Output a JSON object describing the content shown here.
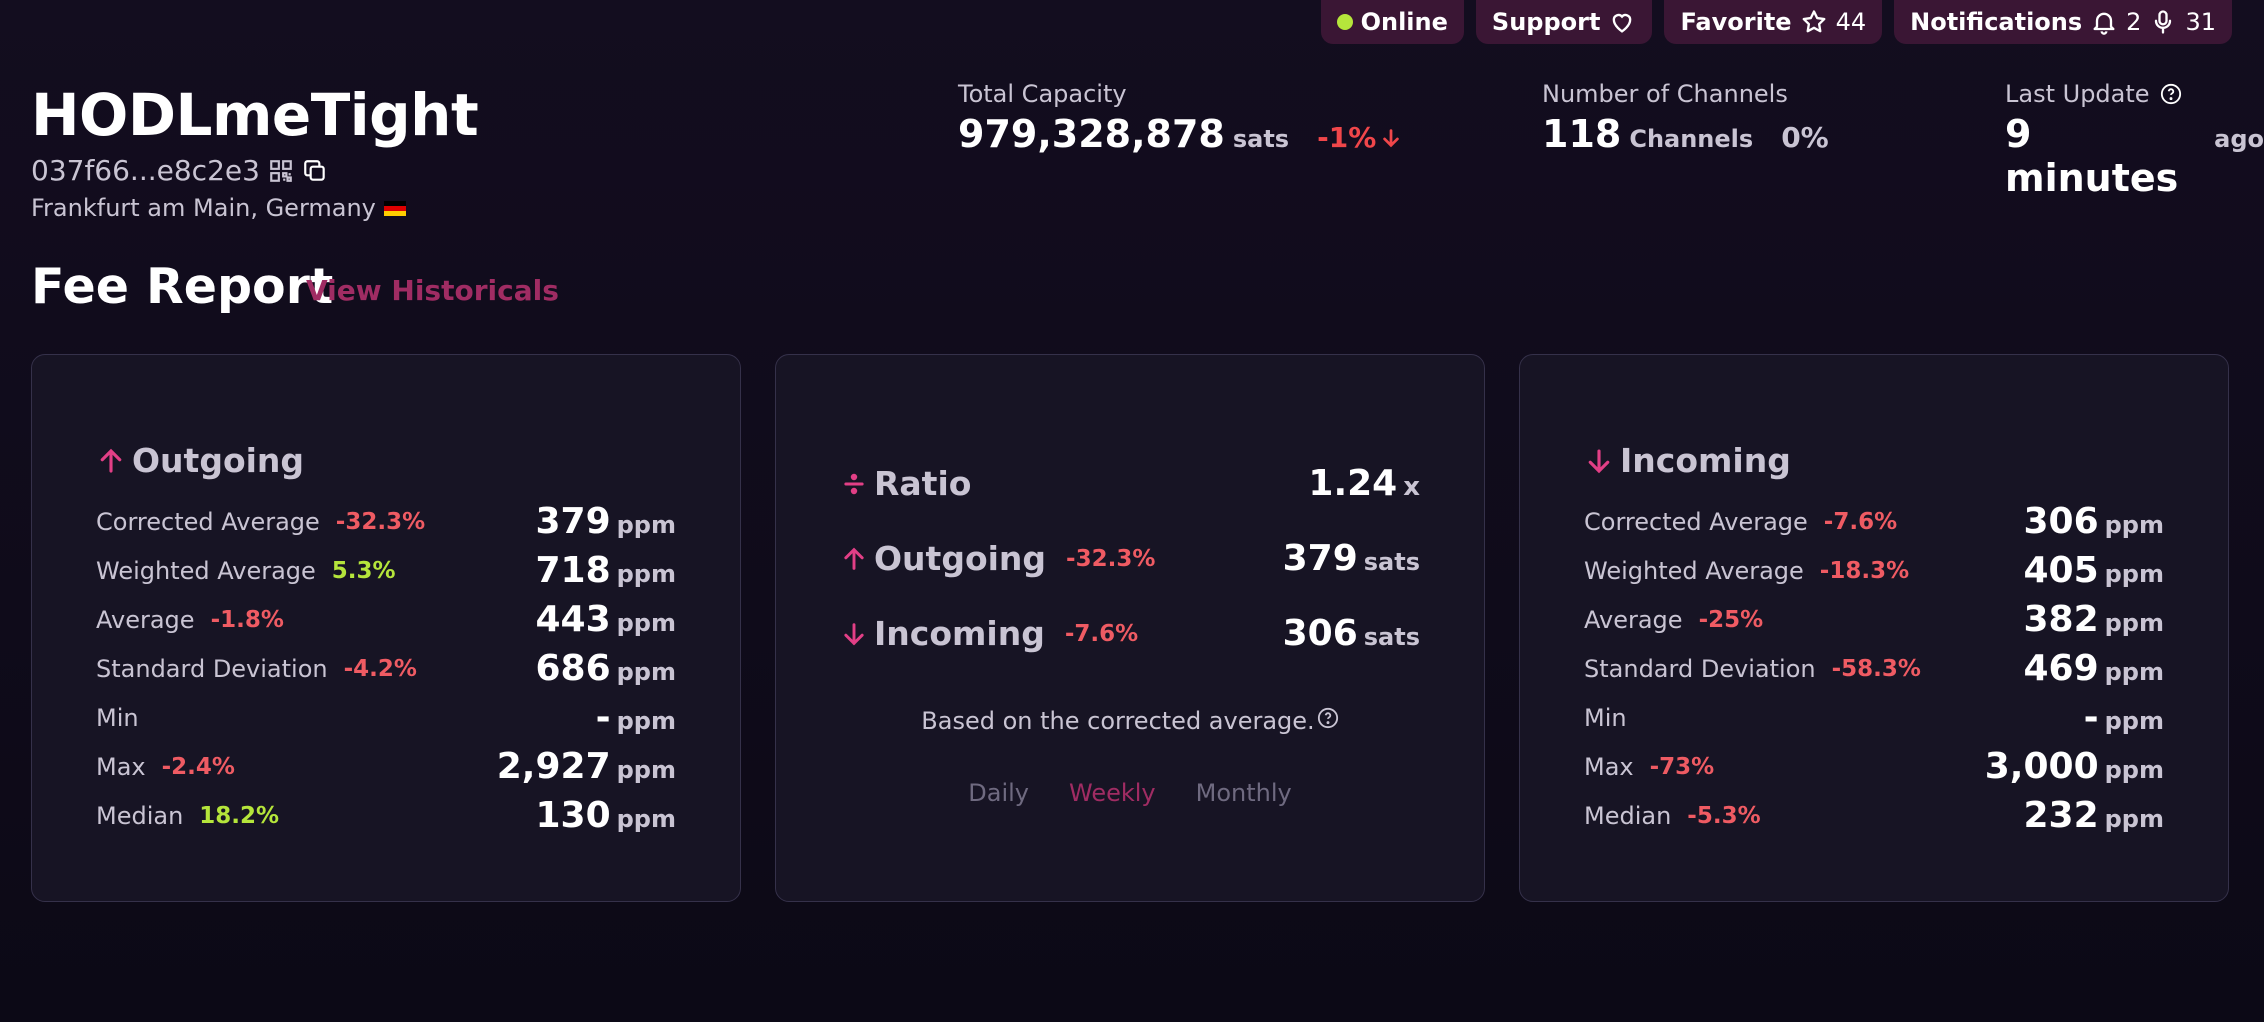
{
  "topbar": {
    "online_label": "Online",
    "support_label": "Support",
    "favorite_label": "Favorite",
    "favorite_count": "44",
    "notifications_label": "Notifications",
    "notifications_bell_count": "2",
    "notifications_mic_count": "31"
  },
  "node": {
    "alias": "HODLmeTight",
    "pubkey": "037f66...e8c2e3",
    "location": "Frankfurt am Main, Germany"
  },
  "stats": {
    "capacity": {
      "label": "Total Capacity",
      "value": "979,328,878",
      "unit": "sats",
      "change": "-1%"
    },
    "channels": {
      "label": "Number of Channels",
      "value": "118",
      "unit": "Channels",
      "change": "0%"
    },
    "last_update": {
      "label": "Last Update",
      "value": "9 minutes",
      "unit": "ago"
    }
  },
  "fee_report": {
    "title": "Fee Report",
    "view_historicals": "View Historicals",
    "outgoing": {
      "title": "Outgoing",
      "rows": [
        {
          "label": "Corrected Average",
          "change": "-32.3%",
          "value": "379",
          "unit": "ppm"
        },
        {
          "label": "Weighted Average",
          "change": "5.3%",
          "value": "718",
          "unit": "ppm"
        },
        {
          "label": "Average",
          "change": "-1.8%",
          "value": "443",
          "unit": "ppm"
        },
        {
          "label": "Standard Deviation",
          "change": "-4.2%",
          "value": "686",
          "unit": "ppm"
        },
        {
          "label": "Min",
          "change": "",
          "value": "-",
          "unit": "ppm"
        },
        {
          "label": "Max",
          "change": "-2.4%",
          "value": "2,927",
          "unit": "ppm"
        },
        {
          "label": "Median",
          "change": "18.2%",
          "value": "130",
          "unit": "ppm"
        }
      ]
    },
    "ratio": {
      "title": "Ratio",
      "value": "1.24",
      "unit": "x",
      "outgoing": {
        "label": "Outgoing",
        "change": "-32.3%",
        "value": "379",
        "unit": "sats"
      },
      "incoming": {
        "label": "Incoming",
        "change": "-7.6%",
        "value": "306",
        "unit": "sats"
      },
      "note": "Based on the corrected average.",
      "tabs": [
        "Daily",
        "Weekly",
        "Monthly"
      ],
      "active_tab": "Weekly"
    },
    "incoming": {
      "title": "Incoming",
      "rows": [
        {
          "label": "Corrected Average",
          "change": "-7.6%",
          "value": "306",
          "unit": "ppm"
        },
        {
          "label": "Weighted Average",
          "change": "-18.3%",
          "value": "405",
          "unit": "ppm"
        },
        {
          "label": "Average",
          "change": "-25%",
          "value": "382",
          "unit": "ppm"
        },
        {
          "label": "Standard Deviation",
          "change": "-58.3%",
          "value": "469",
          "unit": "ppm"
        },
        {
          "label": "Min",
          "change": "",
          "value": "-",
          "unit": "ppm"
        },
        {
          "label": "Max",
          "change": "-73%",
          "value": "3,000",
          "unit": "ppm"
        },
        {
          "label": "Median",
          "change": "-5.3%",
          "value": "232",
          "unit": "ppm"
        }
      ]
    }
  },
  "colors": {
    "accent": "#a02c63",
    "arrow": "#e23f86",
    "negative": "#ef5b63",
    "positive": "#b5e53b",
    "pill_bg": "#3a1634"
  }
}
